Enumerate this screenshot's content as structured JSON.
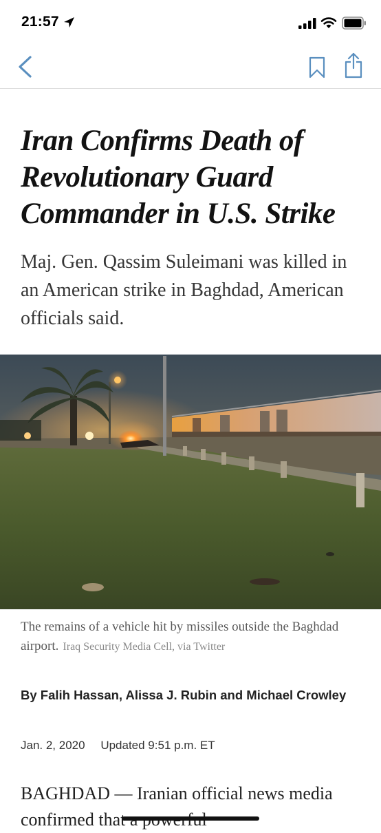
{
  "status_bar": {
    "time": "21:57"
  },
  "nav": {
    "back_icon": "chevron-left-icon",
    "bookmark_icon": "bookmark-icon",
    "share_icon": "share-icon",
    "accent": "#5a8fbf"
  },
  "article": {
    "headline": "Iran Confirms Death of Revolutionary Guard Commander in U.S. Strike",
    "summary": "Maj. Gen. Qassim Suleimani was killed in an American strike in Baghdad, American officials said.",
    "caption": "The remains of a vehicle hit by missiles outside the Baghdad airport.",
    "photo_credit": "Iraq Security Media Cell, via Twitter",
    "byline": "By Falih Hassan, Alissa J. Rubin and Michael Crowley",
    "date": "Jan. 2, 2020",
    "updated": "Updated 9:51 p.m. ET",
    "body_start": "BAGHDAD — Iranian official news media confirmed that a powerful"
  }
}
